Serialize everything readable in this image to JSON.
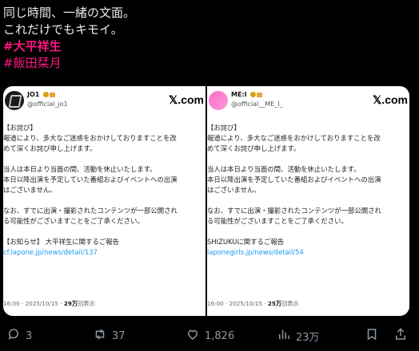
{
  "tweet": {
    "lines": [
      "同じ時間、一緒の文面。",
      "これだけでもキモイ。"
    ],
    "hashtags": [
      "#大平祥生",
      "#飯田栞月"
    ]
  },
  "cards": [
    {
      "name": "JO1",
      "handle": "@official_jo1",
      "logo": "𝕏.com",
      "title": "【お詫び】",
      "p1": [
        "報道により、多大なご迷惑をおかけしておりますことを改",
        "めて深くお詫び申し上げます。"
      ],
      "p2": [
        "当人は本日より当面の間、活動を休止いたします。",
        "本日以降出演を予定していた番組およびイベントへの出演",
        "はございません。"
      ],
      "p3": [
        "なお、すでに出演・撮影されたコンテンツが一部公開され",
        "る可能性がございますことをご了承ください。"
      ],
      "notice": "【お知らせ】 大平祥生に関するご報告",
      "url": "cf.lapone.jp/news/detail/137",
      "time": "16:00 · 2025/10/15 · ",
      "views": "29万",
      "views_suffix": "回表示"
    },
    {
      "name": "ME:I",
      "handle": "@official__ME_I_",
      "logo": "𝕏.com",
      "title": "【お詫び】",
      "p1": [
        "報道により、多大なご迷惑をおかけしておりますことを改",
        "めて深くお詫び申し上げます。"
      ],
      "p2": [
        "当人は本日より当面の間、活動を休止いたします。",
        "本日以降出演を予定していた番組およびイベントへの出演",
        "はございません。"
      ],
      "p3": [
        "なお、すでに出演・撮影されたコンテンツが一部公開され",
        "る可能性がございますことをご了承ください。"
      ],
      "notice": "SHIZUKUに関するご報告",
      "url": "laponegirls.jp/news/detail/54",
      "time": "16:00 · 2025/10/15 · ",
      "views": "25万",
      "views_suffix": "回表示"
    }
  ],
  "actions": {
    "replies": "3",
    "reposts": "37",
    "likes": "1,826",
    "views": "23万"
  },
  "icons": [
    "reply-icon",
    "repost-icon",
    "like-icon",
    "views-icon",
    "bookmark-icon",
    "share-icon"
  ]
}
